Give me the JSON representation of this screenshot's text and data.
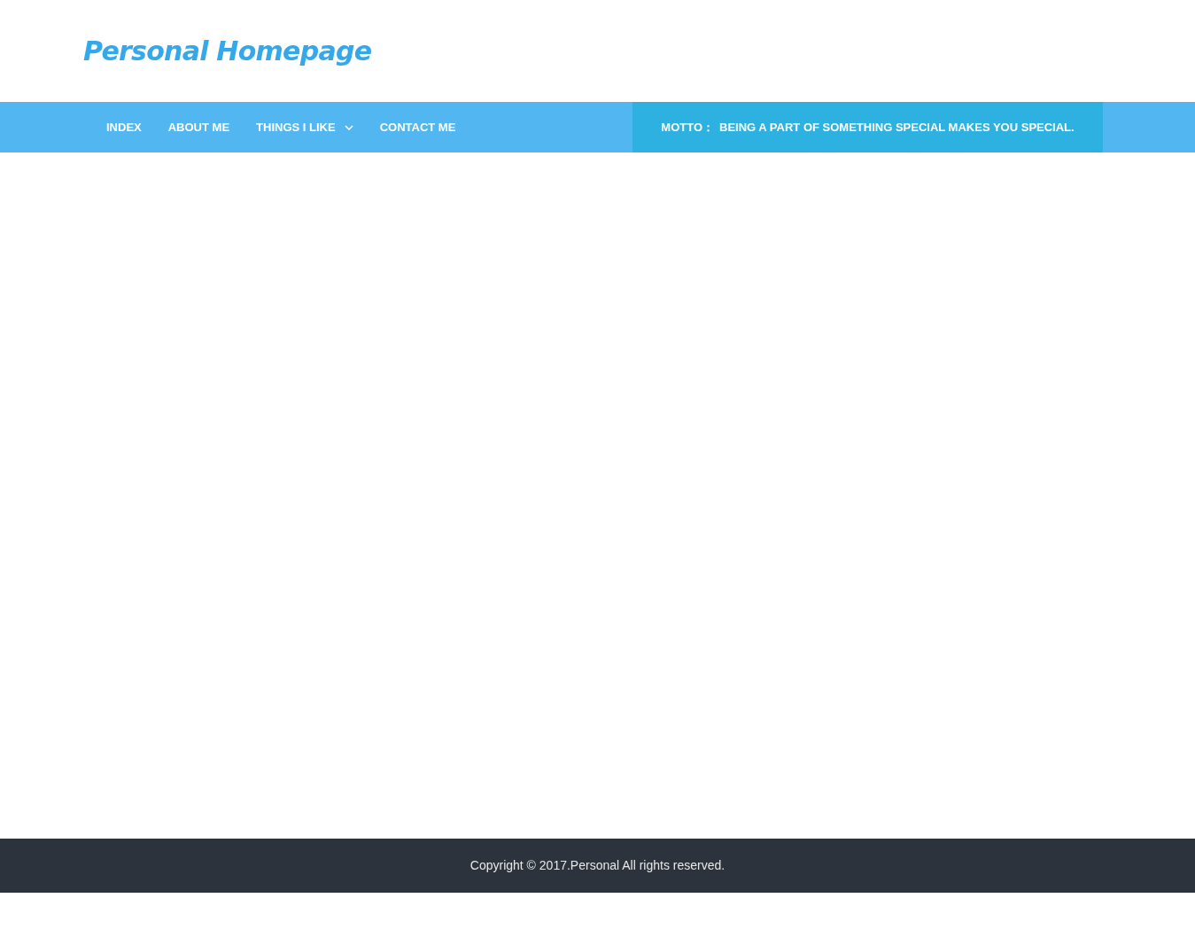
{
  "site_title": "Personal Homepage",
  "nav": [
    {
      "label": "INDEX",
      "has_dropdown": false
    },
    {
      "label": "ABOUT ME",
      "has_dropdown": false
    },
    {
      "label": "THINGS I LIKE",
      "has_dropdown": true
    },
    {
      "label": "CONTACT ME",
      "has_dropdown": false
    }
  ],
  "motto": {
    "label": "MOTTO：",
    "text": "BEING A PART OF SOMETHING SPECIAL MAKES YOU SPECIAL."
  },
  "footer": "Copyright © 2017.Personal All rights reserved."
}
